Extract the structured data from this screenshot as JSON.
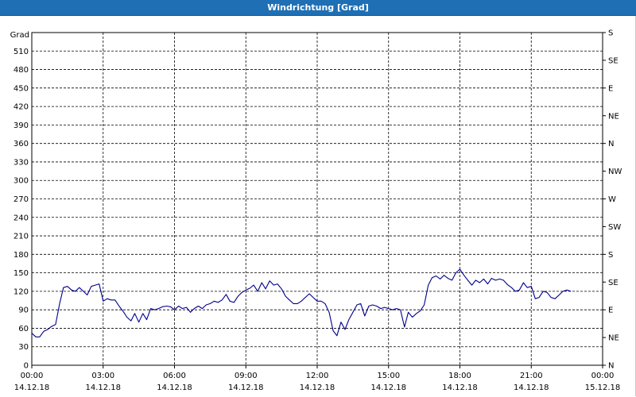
{
  "window": {
    "title": "Windrichtung [Grad]"
  },
  "chart_data": {
    "type": "line",
    "title": "Windrichtung [Grad]",
    "ylabel": "Grad",
    "ylim": [
      0,
      540
    ],
    "xlim": [
      "14.12.18 00:00",
      "15.12.18 00:00"
    ],
    "grid": true,
    "y_ticks": [
      "0",
      "30",
      "60",
      "90",
      "120",
      "150",
      "180",
      "210",
      "240",
      "270",
      "300",
      "330",
      "360",
      "390",
      "420",
      "450",
      "480",
      "510"
    ],
    "y2_ticks": [
      "N",
      "NE",
      "E",
      "SE",
      "S",
      "SW",
      "W",
      "NW",
      "N",
      "NE",
      "E",
      "SE",
      "S"
    ],
    "x_ticks": [
      {
        "time": "00:00",
        "date": "14.12.18"
      },
      {
        "time": "03:00",
        "date": "14.12.18"
      },
      {
        "time": "06:00",
        "date": "14.12.18"
      },
      {
        "time": "09:00",
        "date": "14.12.18"
      },
      {
        "time": "12:00",
        "date": "14.12.18"
      },
      {
        "time": "15:00",
        "date": "14.12.18"
      },
      {
        "time": "18:00",
        "date": "14.12.18"
      },
      {
        "time": "21:00",
        "date": "14.12.18"
      },
      {
        "time": "00:00",
        "date": "15.12.18"
      }
    ],
    "series": [
      {
        "color": "#00008b",
        "x_hours": [
          0,
          0.17,
          0.33,
          0.5,
          0.67,
          0.83,
          1.0,
          1.17,
          1.33,
          1.5,
          1.67,
          1.83,
          2.0,
          2.17,
          2.33,
          2.5,
          2.67,
          2.83,
          3.0,
          3.17,
          3.33,
          3.5,
          3.67,
          3.83,
          4.0,
          4.17,
          4.33,
          4.5,
          4.67,
          4.83,
          5.0,
          5.17,
          5.33,
          5.5,
          5.67,
          5.83,
          6.0,
          6.17,
          6.33,
          6.5,
          6.67,
          6.83,
          7.0,
          7.17,
          7.33,
          7.5,
          7.67,
          7.83,
          8.0,
          8.17,
          8.33,
          8.5,
          8.67,
          8.83,
          9.0,
          9.17,
          9.33,
          9.5,
          9.67,
          9.83,
          10.0,
          10.17,
          10.33,
          10.5,
          10.67,
          10.83,
          11.0,
          11.17,
          11.33,
          11.5,
          11.67,
          11.83,
          12.0,
          12.17,
          12.33,
          12.5,
          12.67,
          12.83,
          13.0,
          13.17,
          13.33,
          13.5,
          13.67,
          13.83,
          14.0,
          14.17,
          14.33,
          14.5,
          14.67,
          14.83,
          15.0,
          15.17,
          15.33,
          15.5,
          15.67,
          15.83,
          16.0,
          16.17,
          16.33,
          16.5,
          16.67,
          16.83,
          17.0,
          17.17,
          17.33,
          17.5,
          17.67,
          17.83,
          18.0,
          18.17,
          18.33,
          18.5,
          18.67,
          18.83,
          19.0,
          19.17,
          19.33,
          19.5,
          19.67,
          19.83,
          20.0,
          20.17,
          20.33,
          20.5,
          20.67,
          20.83,
          21.0,
          21.17,
          21.33,
          21.5,
          21.67,
          21.83,
          22.0,
          22.17,
          22.33,
          22.5,
          22.67,
          22.83,
          23.0,
          23.17,
          23.33,
          23.5,
          23.67,
          23.83,
          24.0
        ],
        "values": [
          52,
          46,
          46,
          55,
          58,
          63,
          66,
          100,
          126,
          128,
          122,
          120,
          126,
          120,
          114,
          128,
          130,
          132,
          104,
          108,
          106,
          106,
          96,
          88,
          78,
          72,
          84,
          70,
          84,
          74,
          92,
          90,
          92,
          95,
          96,
          95,
          90,
          96,
          92,
          94,
          86,
          92,
          96,
          92,
          98,
          100,
          104,
          102,
          106,
          115,
          104,
          102,
          112,
          118,
          122,
          125,
          130,
          120,
          134,
          124,
          137,
          130,
          132,
          124,
          112,
          106,
          100,
          100,
          104,
          110,
          116,
          110,
          104,
          104,
          100,
          86,
          56,
          48,
          70,
          58,
          74,
          86,
          98,
          100,
          80,
          96,
          98,
          96,
          92,
          94,
          92,
          90,
          92,
          90,
          62,
          86,
          78,
          84,
          88,
          98,
          130,
          142,
          145,
          140,
          146,
          141,
          138,
          150,
          156,
          146,
          138,
          130,
          138,
          134,
          140,
          132,
          141,
          138,
          140,
          138,
          131,
          126,
          120,
          122,
          134,
          126,
          128,
          108,
          110,
          120,
          118,
          110,
          108,
          114,
          120,
          122,
          120
        ]
      }
    ]
  }
}
